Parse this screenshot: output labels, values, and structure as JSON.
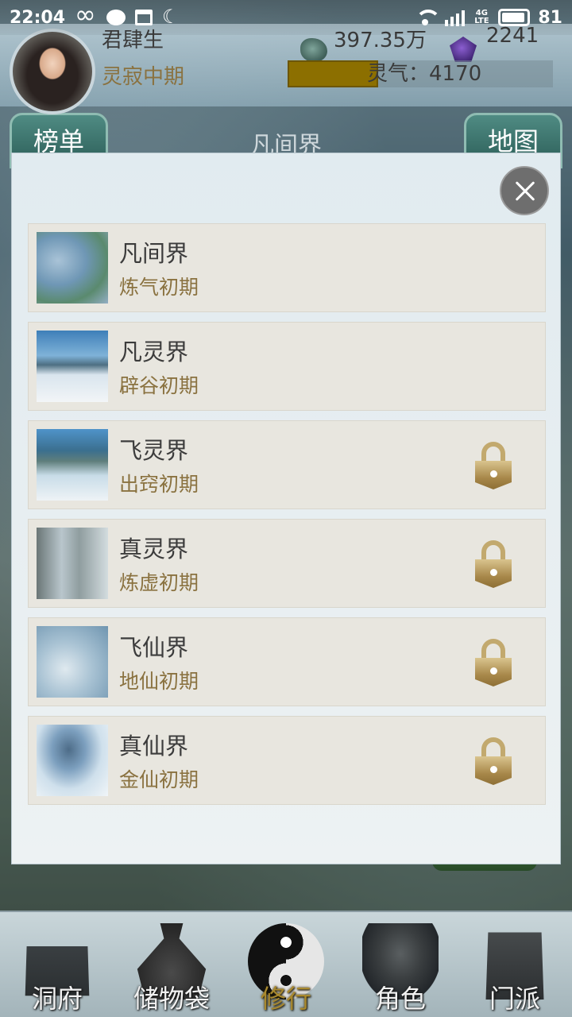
{
  "status_bar": {
    "time": "22:04",
    "network_label": "4G LTE",
    "battery": "81",
    "icons": [
      "infinity-icon",
      "chat-icon",
      "calendar-icon",
      "moon-icon",
      "wifi-icon",
      "signal-icon",
      "battery-icon"
    ]
  },
  "player": {
    "name": "君肆生",
    "realm": "灵寂中期",
    "gold": "397.35万",
    "gems": "2241",
    "qi_label": "灵气：4170",
    "qi_fill_fraction": 0.34
  },
  "header": {
    "rank_button": "榜单",
    "map_button": "地图",
    "current_realm": "凡间界"
  },
  "realm_list": {
    "items": [
      {
        "name": "凡间界",
        "requirement": "炼气初期",
        "locked": false
      },
      {
        "name": "凡灵界",
        "requirement": "辟谷初期",
        "locked": false
      },
      {
        "name": "飞灵界",
        "requirement": "出窍初期",
        "locked": true
      },
      {
        "name": "真灵界",
        "requirement": "炼虚初期",
        "locked": true
      },
      {
        "name": "飞仙界",
        "requirement": "地仙初期",
        "locked": true
      },
      {
        "name": "真仙界",
        "requirement": "金仙初期",
        "locked": true
      }
    ]
  },
  "bottom_nav": {
    "items": [
      {
        "label": "洞府",
        "icon": "cave-dwelling-icon",
        "active": false
      },
      {
        "label": "储物袋",
        "icon": "storage-bag-icon",
        "active": false
      },
      {
        "label": "修行",
        "icon": "yin-yang-icon",
        "active": true
      },
      {
        "label": "角色",
        "icon": "character-icon",
        "active": false
      },
      {
        "label": "门派",
        "icon": "sect-tower-icon",
        "active": false
      }
    ]
  },
  "colors": {
    "accent_gold": "#8a7240",
    "qi_bar": "#8c6f00",
    "active_nav": "#a9892e"
  }
}
